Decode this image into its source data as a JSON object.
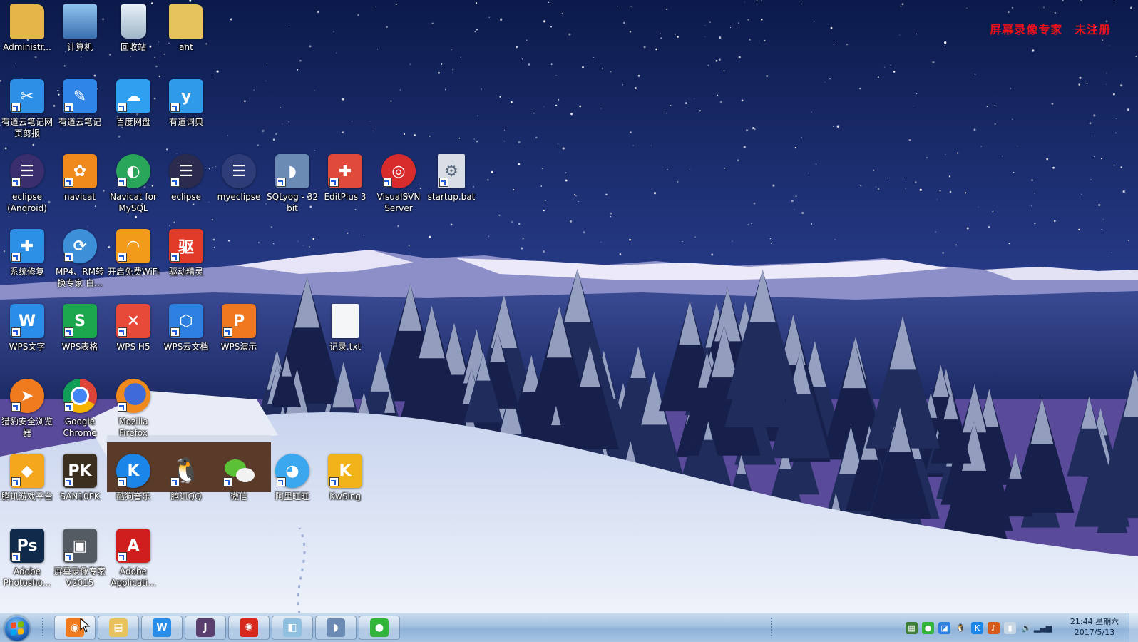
{
  "watermark": {
    "product": "屏幕录像专家",
    "status": "未注册"
  },
  "desktop_icons": [
    {
      "id": "administrator",
      "label": "Administr...",
      "icon": "user-folder-icon",
      "bg": "#e4b548",
      "glyph": "",
      "shortcut": false
    },
    {
      "id": "computer",
      "label": "计算机",
      "icon": "computer-icon",
      "bg": "#4b7fb8",
      "glyph": "",
      "shortcut": false
    },
    {
      "id": "recycle-bin",
      "label": "回收站",
      "icon": "recycle-bin-icon",
      "bg": "#9fb6c9",
      "glyph": "",
      "shortcut": false
    },
    {
      "id": "ant",
      "label": "ant",
      "icon": "folder-icon",
      "bg": "#e7c35d",
      "glyph": "",
      "shortcut": false
    },
    {
      "id": "youdao-clipper",
      "label": "有道云笔记网页剪报",
      "icon": "web-clipper-icon",
      "bg": "#2d8fe6",
      "glyph": "✂",
      "shortcut": true
    },
    {
      "id": "youdao-note",
      "label": "有道云笔记",
      "icon": "youdao-note-icon",
      "bg": "#2f86e8",
      "glyph": "✎",
      "shortcut": true
    },
    {
      "id": "baidu-pan",
      "label": "百度网盘",
      "icon": "baidu-cloud-icon",
      "bg": "#2f9ff0",
      "glyph": "☁",
      "shortcut": true
    },
    {
      "id": "youdao-dict",
      "label": "有道词典",
      "icon": "youdao-dict-icon",
      "bg": "#2f9ae8",
      "glyph": "y",
      "shortcut": true
    },
    {
      "id": "eclipse-android",
      "label": "eclipse (Android)",
      "icon": "eclipse-icon",
      "bg": "#3a2e6e",
      "glyph": "☰",
      "shortcut": true
    },
    {
      "id": "navicat",
      "label": "navicat",
      "icon": "navicat-icon",
      "bg": "#f08a1c",
      "glyph": "✿",
      "shortcut": true
    },
    {
      "id": "navicat-mysql",
      "label": "Navicat for MySQL",
      "icon": "navicat-mysql-icon",
      "bg": "#2aa65a",
      "glyph": "◐",
      "shortcut": true
    },
    {
      "id": "eclipse",
      "label": "eclipse",
      "icon": "eclipse-icon",
      "bg": "#2b2b4e",
      "glyph": "☰",
      "shortcut": true
    },
    {
      "id": "myeclipse",
      "label": "myeclipse",
      "icon": "myeclipse-icon",
      "bg": "#2e3d78",
      "glyph": "☰",
      "shortcut": false
    },
    {
      "id": "sqlyog",
      "label": "SQLyog - 32 bit",
      "icon": "dolphin-icon",
      "bg": "#6b8bb5",
      "glyph": "◗",
      "shortcut": true
    },
    {
      "id": "editplus",
      "label": "EditPlus 3",
      "icon": "editplus-icon",
      "bg": "#e04a3a",
      "glyph": "✚",
      "shortcut": true
    },
    {
      "id": "visualsvn",
      "label": "VisualSVN Server",
      "icon": "visualsvn-icon",
      "bg": "#d82c2c",
      "glyph": "◎",
      "shortcut": true
    },
    {
      "id": "startup-bat",
      "label": "startup.bat",
      "icon": "batch-file-icon",
      "bg": "#d9dee6",
      "glyph": "⚙",
      "shortcut": true
    },
    {
      "id": "system-repair",
      "label": "系统修复",
      "icon": "doctor-icon",
      "bg": "#2c8fe6",
      "glyph": "✚",
      "shortcut": true
    },
    {
      "id": "mp4-converter",
      "label": "MP4、RM转换专家 白...",
      "icon": "converter-icon",
      "bg": "#3d8fd8",
      "glyph": "⟳",
      "shortcut": true
    },
    {
      "id": "free-wifi",
      "label": "开启免费WiFi",
      "icon": "wifi-icon",
      "bg": "#f29b1a",
      "glyph": "◠",
      "shortcut": true
    },
    {
      "id": "driver-genius",
      "label": "驱动精灵",
      "icon": "driver-genius-icon",
      "bg": "#e23b2a",
      "glyph": "驱",
      "shortcut": true
    },
    {
      "id": "wps-writer",
      "label": "WPS文字",
      "icon": "wps-writer-icon",
      "bg": "#2a8de8",
      "glyph": "W",
      "shortcut": true
    },
    {
      "id": "wps-sheet",
      "label": "WPS表格",
      "icon": "wps-sheet-icon",
      "bg": "#1aa64d",
      "glyph": "S",
      "shortcut": true
    },
    {
      "id": "wps-h5",
      "label": "WPS H5",
      "icon": "wps-h5-icon",
      "bg": "#e84a3a",
      "glyph": "✕",
      "shortcut": true
    },
    {
      "id": "wps-cloud",
      "label": "WPS云文档",
      "icon": "wps-cloud-icon",
      "bg": "#2d7fe0",
      "glyph": "⬡",
      "shortcut": true
    },
    {
      "id": "wps-present",
      "label": "WPS演示",
      "icon": "wps-present-icon",
      "bg": "#f0781e",
      "glyph": "P",
      "shortcut": true
    },
    {
      "id": "record-txt",
      "label": "记录.txt",
      "icon": "text-file-icon",
      "bg": "#f4f6f8",
      "glyph": "",
      "shortcut": false
    },
    {
      "id": "liebao",
      "label": "猎豹安全浏览器",
      "icon": "liebao-browser-icon",
      "bg": "#f07a1e",
      "glyph": "➤",
      "shortcut": true
    },
    {
      "id": "chrome",
      "label": "Google Chrome",
      "icon": "chrome-icon",
      "bg": "#e9e9e9",
      "glyph": "",
      "shortcut": true
    },
    {
      "id": "firefox",
      "label": "Mozilla Firefox",
      "icon": "firefox-icon",
      "bg": "#e8741c",
      "glyph": "",
      "shortcut": true
    },
    {
      "id": "tencent-games",
      "label": "腾讯游戏平台",
      "icon": "tencent-games-icon",
      "bg": "#f4a61c",
      "glyph": "◆",
      "shortcut": true
    },
    {
      "id": "san10pk",
      "label": "SAN10PK",
      "icon": "san10pk-icon",
      "bg": "#3b3020",
      "glyph": "PK",
      "shortcut": true
    },
    {
      "id": "kugou",
      "label": "酷狗音乐",
      "icon": "kugou-icon",
      "bg": "#1c86e8",
      "glyph": "K",
      "shortcut": true
    },
    {
      "id": "tencent-qq",
      "label": "腾讯QQ",
      "icon": "qq-penguin-icon",
      "bg": "transparent",
      "glyph": "🐧",
      "shortcut": true
    },
    {
      "id": "wechat",
      "label": "微信",
      "icon": "wechat-icon",
      "bg": "transparent",
      "glyph": "",
      "shortcut": true
    },
    {
      "id": "aliwangwang",
      "label": "阿里旺旺",
      "icon": "aliwangwang-icon",
      "bg": "#3aa7ef",
      "glyph": "◕",
      "shortcut": true
    },
    {
      "id": "kwsing",
      "label": "KwSing",
      "icon": "kwsing-icon",
      "bg": "#f2b31a",
      "glyph": "K",
      "shortcut": true
    },
    {
      "id": "photoshop",
      "label": "Adobe Photosho...",
      "icon": "photoshop-icon",
      "bg": "#0f2a4a",
      "glyph": "Ps",
      "shortcut": true
    },
    {
      "id": "screen-recorder",
      "label": "屏幕录像专家 V2015",
      "icon": "video-camera-icon",
      "bg": "#555b63",
      "glyph": "▣",
      "shortcut": true
    },
    {
      "id": "adobe-app",
      "label": "Adobe Applicati...",
      "icon": "adobe-icon",
      "bg": "#d01e1e",
      "glyph": "A",
      "shortcut": true
    }
  ],
  "taskbar": {
    "buttons": [
      {
        "id": "tb-browser",
        "icon": "browser-icon",
        "bg": "#f07a1e",
        "glyph": "◉",
        "active": true
      },
      {
        "id": "tb-explorer",
        "icon": "folder-icon",
        "bg": "#e7c35d",
        "glyph": "▤",
        "active": false
      },
      {
        "id": "tb-wps",
        "icon": "wps-writer-icon",
        "bg": "#2a8de8",
        "glyph": "W",
        "active": false
      },
      {
        "id": "tb-javaee",
        "icon": "java-ee-icon",
        "bg": "#5a3f6e",
        "glyph": "J",
        "active": false
      },
      {
        "id": "tb-app-red",
        "icon": "red-app-icon",
        "bg": "#d6281d",
        "glyph": "✺",
        "active": false
      },
      {
        "id": "tb-blue-app",
        "icon": "blue-window-icon",
        "bg": "#8fc0e0",
        "glyph": "◧",
        "active": false
      },
      {
        "id": "tb-sqlyog",
        "icon": "dolphin-icon",
        "bg": "#6b8bb5",
        "glyph": "◗",
        "active": false
      },
      {
        "id": "tb-wechat",
        "icon": "wechat-icon",
        "bg": "#33b53c",
        "glyph": "●",
        "active": false
      }
    ],
    "tray": [
      {
        "id": "tray-network-app",
        "icon": "network-app-icon",
        "bg": "#3e7d3a",
        "glyph": "▦"
      },
      {
        "id": "tray-wechat",
        "icon": "wechat-icon",
        "bg": "#33b53c",
        "glyph": "●"
      },
      {
        "id": "tray-connect",
        "icon": "connect-icon",
        "bg": "#2d7fe0",
        "glyph": "◪"
      },
      {
        "id": "tray-qq",
        "icon": "qq-penguin-icon",
        "bg": "transparent",
        "glyph": "🐧"
      },
      {
        "id": "tray-kugou",
        "icon": "kugou-icon",
        "bg": "#1c86e8",
        "glyph": "K"
      },
      {
        "id": "tray-audio-app",
        "icon": "speaker-app-icon",
        "bg": "#d65a1a",
        "glyph": "♪"
      },
      {
        "id": "tray-device",
        "icon": "usb-device-icon",
        "bg": "#c9d6e4",
        "glyph": "▮"
      },
      {
        "id": "tray-volume",
        "icon": "volume-icon",
        "bg": "transparent",
        "glyph": "🔊"
      },
      {
        "id": "tray-signal",
        "icon": "network-signal-icon",
        "bg": "transparent",
        "glyph": "▂▄▆"
      }
    ],
    "clock": {
      "time": "21:44 星期六",
      "date": "2017/5/13"
    }
  },
  "colors": {
    "watermark": "#e8121a",
    "taskbar": "#a3c1e0",
    "sky_top": "#0c1a4a",
    "snow": "#e9eef8"
  }
}
